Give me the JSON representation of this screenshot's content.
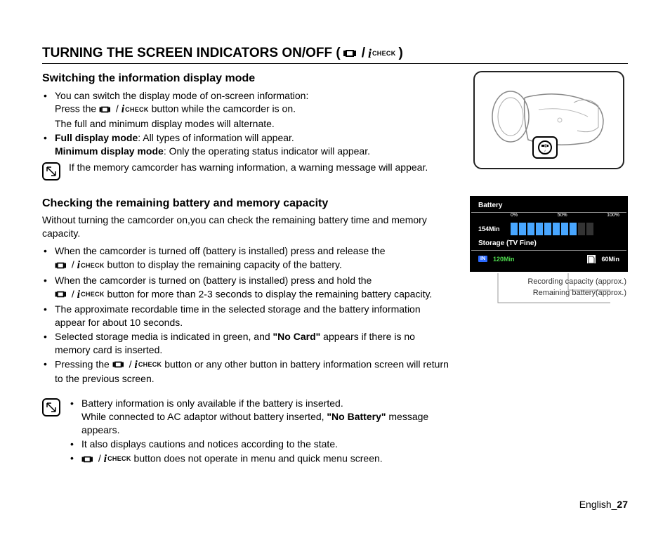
{
  "header": {
    "title_a": "TURNING THE SCREEN INDICATORS ON/OFF (",
    "title_b": "/",
    "title_c": ")",
    "check_text": "CHECK"
  },
  "s1": {
    "title": "Switching the information display mode",
    "b1a": "You can switch the display mode of on-screen information:",
    "b1b_a": "Press the",
    "b1b_b": "/",
    "b1b_c": "button while the camcorder is on.",
    "b1c": "The full and minimum display modes will alternate.",
    "b2_bold": "Full display mode",
    "b2_rest": ": All types of information will appear.",
    "b3_bold": "Minimum display mode",
    "b3_rest": ": Only the operating status indicator will appear.",
    "note": "If the memory camcorder has warning information, a warning message will appear."
  },
  "s2": {
    "title": "Checking the remaining battery and memory capacity",
    "intro": "Without turning the camcorder on,you can check the remaining battery time and memory capacity.",
    "b1a": "When the camcorder is turned off (battery is installed) press and release the",
    "b1b": "button to display the remaining capacity of the battery.",
    "b2a": "When the camcorder is turned on (battery is installed) press and hold the",
    "b2b": "button for more than 2-3 seconds to display the remaining battery capacity.",
    "b3": "The approximate recordable time in the selected storage and the battery information appear for about 10 seconds.",
    "b4a": "Selected storage media is indicated in green, and ",
    "b4_bold": "\"No Card\"",
    "b4b": " appears if there is no memory card is inserted.",
    "b5a": "Pressing the",
    "b5b": "button or any other button in battery information screen will return to the previous screen.",
    "n1a": "Battery information is only available if the battery is inserted.",
    "n1b_a": "While connected to AC adaptor without battery inserted, ",
    "n1b_bold": "\"No Battery\"",
    "n1b_b": " message appears.",
    "n2": "It also displays cautions and notices according to the state.",
    "n3": "button does not operate in menu and quick menu screen."
  },
  "panel": {
    "battery_label": "Battery",
    "pct0": "0%",
    "pct50": "50%",
    "pct100": "100%",
    "time": "154Min",
    "storage_label": "Storage (TV Fine)",
    "in": "IN",
    "storage_time": "120Min",
    "card_time": "60Min",
    "caption1": "Recording capacity (approx.)",
    "caption2": "Remaining battery(approx.)"
  },
  "footer": {
    "lang": "English_",
    "page": "27"
  },
  "chart_data": {
    "type": "bar",
    "title": "Battery / Storage status display",
    "battery": {
      "remaining_minutes": 154,
      "bar_segments_total": 10,
      "bar_segments_filled": 8,
      "scale_labels": [
        "0%",
        "50%",
        "100%"
      ],
      "approx_percent": 80
    },
    "storage": [
      {
        "media": "IN",
        "remaining_minutes": 120,
        "highlight": "green"
      },
      {
        "media": "Card",
        "remaining_minutes": 60,
        "highlight": "white"
      }
    ]
  }
}
